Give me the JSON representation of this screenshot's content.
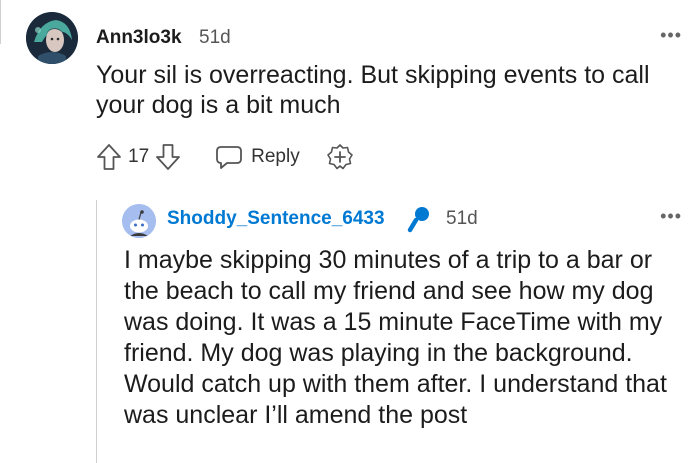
{
  "comment": {
    "username": "Ann3lo3k",
    "age": "51d",
    "more_label": "•••",
    "body": "Your sil is overreacting. But skipping events to call your dog is a bit much",
    "votes": "17",
    "reply_label": "Reply",
    "avatar_icon": "avatar-fantasy-portrait",
    "upvote_icon": "upvote-arrow-icon",
    "downvote_icon": "downvote-arrow-icon",
    "reply_icon": "speech-bubble-icon",
    "award_icon": "award-plus-icon"
  },
  "reply": {
    "username": "Shoddy_Sentence_6433",
    "age": "51d",
    "more_label": "•••",
    "body": "I maybe skipping 30 minutes of a trip to a bar or the beach to call my friend and see how my dog was doing. It was a 15 minute FaceTime with my friend. My dog was playing in the background. Would catch up with them after. I understand that was unclear I’ll amend the post",
    "avatar_icon": "snoo-avatar-icon",
    "badge_icon": "microphone-icon"
  },
  "colors": {
    "username_link": "#0079d3",
    "text": "#1c1c1c",
    "meta": "#555555",
    "thread_line": "#d0d0d0"
  }
}
